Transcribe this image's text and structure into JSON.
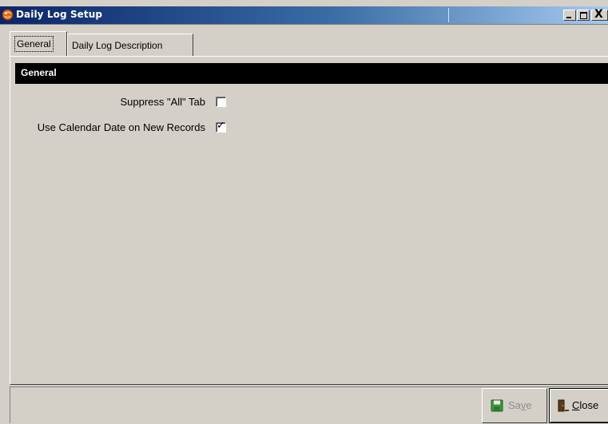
{
  "window": {
    "title": "Daily Log Setup",
    "controls": {
      "minimize": "_",
      "maximize": "□",
      "close": "X"
    }
  },
  "tabs": [
    {
      "label": "General",
      "selected": true
    },
    {
      "label": "Daily Log Description",
      "selected": false
    }
  ],
  "section": {
    "header": "General"
  },
  "fields": [
    {
      "label": "Suppress \"All\" Tab",
      "checked": false
    },
    {
      "label": "Use Calendar Date on New Records",
      "checked": true
    }
  ],
  "buttons": {
    "save": {
      "pre": "Sa",
      "accel": "v",
      "post": "e",
      "enabled": false
    },
    "close": {
      "pre": "",
      "accel": "C",
      "post": "lose",
      "enabled": true
    }
  },
  "colors": {
    "titlebar_start": "#0a246a",
    "titlebar_end": "#a6caf0",
    "section_header_bg": "#000000",
    "window_bg": "#d4d0c8"
  },
  "icons": {
    "app": "app-globe-icon",
    "save": "floppy-disk-icon",
    "close": "door-exit-icon"
  }
}
